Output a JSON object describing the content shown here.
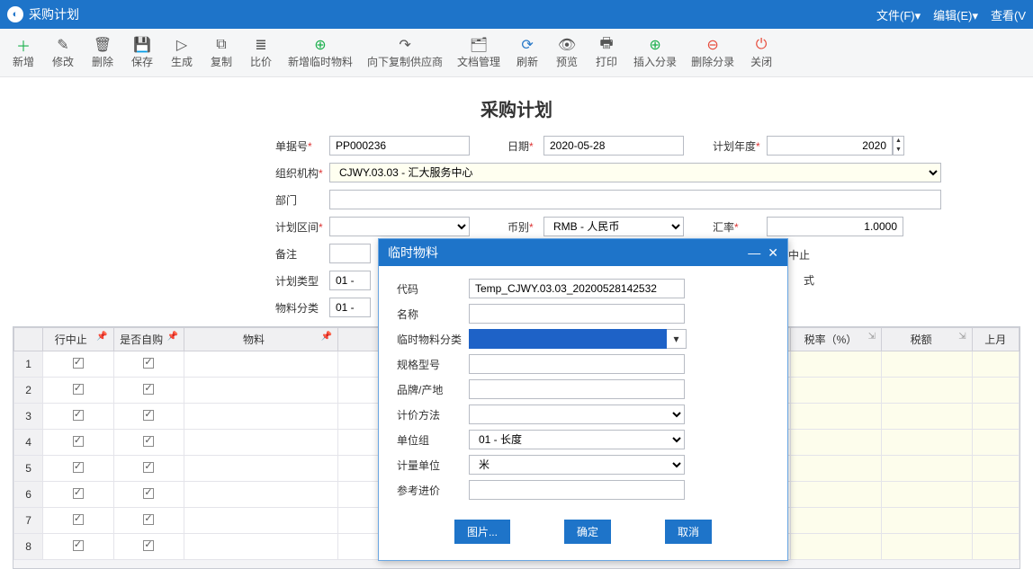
{
  "window": {
    "title": "采购计划"
  },
  "menus": {
    "file": "文件(F)▾",
    "edit": "编辑(E)▾",
    "view": "查看(V"
  },
  "toolbar": {
    "add": "新增",
    "modify": "修改",
    "delete": "删除",
    "save": "保存",
    "generate": "生成",
    "copy": "复制",
    "compare": "比价",
    "addTemp": "新增临时物料",
    "copySupplier": "向下复制供应商",
    "docMgmt": "文档管理",
    "refresh": "刷新",
    "preview": "预览",
    "print": "打印",
    "insertRow": "插入分录",
    "deleteRow": "删除分录",
    "close": "关闭"
  },
  "form": {
    "heading": "采购计划",
    "labels": {
      "docNo": "单据号",
      "date": "日期",
      "planYear": "计划年度",
      "org": "组织机构",
      "dept": "部门",
      "planInterval": "计划区间",
      "currency": "币别",
      "rate": "汇率",
      "remark": "备注",
      "planType": "计划类型",
      "matClass": "物料分类",
      "stop": "中止"
    },
    "values": {
      "docNo": "PP000236",
      "date": "2020-05-28",
      "planYear": "2020",
      "org": "CJWY.03.03 - 汇大服务中心",
      "dept": "",
      "planInterval": "",
      "currency": "RMB - 人民币",
      "rate": "1.0000",
      "remark": "",
      "planType": "01 -",
      "matClass": "01 -"
    }
  },
  "grid": {
    "headers": {
      "rowStop": "行中止",
      "selfBuy": "是否自购",
      "material": "物料",
      "taxRate": "税率（%）",
      "taxAmt": "税额",
      "lastMonth": "上月"
    },
    "rows": [
      {
        "n": 1,
        "stop": true,
        "self": true
      },
      {
        "n": 2,
        "stop": true,
        "self": true
      },
      {
        "n": 3,
        "stop": true,
        "self": true
      },
      {
        "n": 4,
        "stop": true,
        "self": true
      },
      {
        "n": 5,
        "stop": true,
        "self": true
      },
      {
        "n": 6,
        "stop": true,
        "self": true
      },
      {
        "n": 7,
        "stop": true,
        "self": true
      },
      {
        "n": 8,
        "stop": true,
        "self": true
      }
    ]
  },
  "dialog": {
    "title": "临时物料",
    "labels": {
      "code": "代码",
      "name": "名称",
      "tempClass": "临时物料分类",
      "spec": "规格型号",
      "brand": "品牌/产地",
      "valuation": "计价方法",
      "unitGroup": "单位组",
      "unit": "计量单位",
      "refPrice": "参考进价"
    },
    "values": {
      "code": "Temp_CJWY.03.03_20200528142532",
      "name": "",
      "tempClass": "",
      "spec": "",
      "brand": "",
      "valuation": "",
      "unitGroup": "01 - 长度",
      "unit": "米",
      "refPrice": ""
    },
    "buttons": {
      "image": "图片...",
      "ok": "确定",
      "cancel": "取消"
    }
  }
}
